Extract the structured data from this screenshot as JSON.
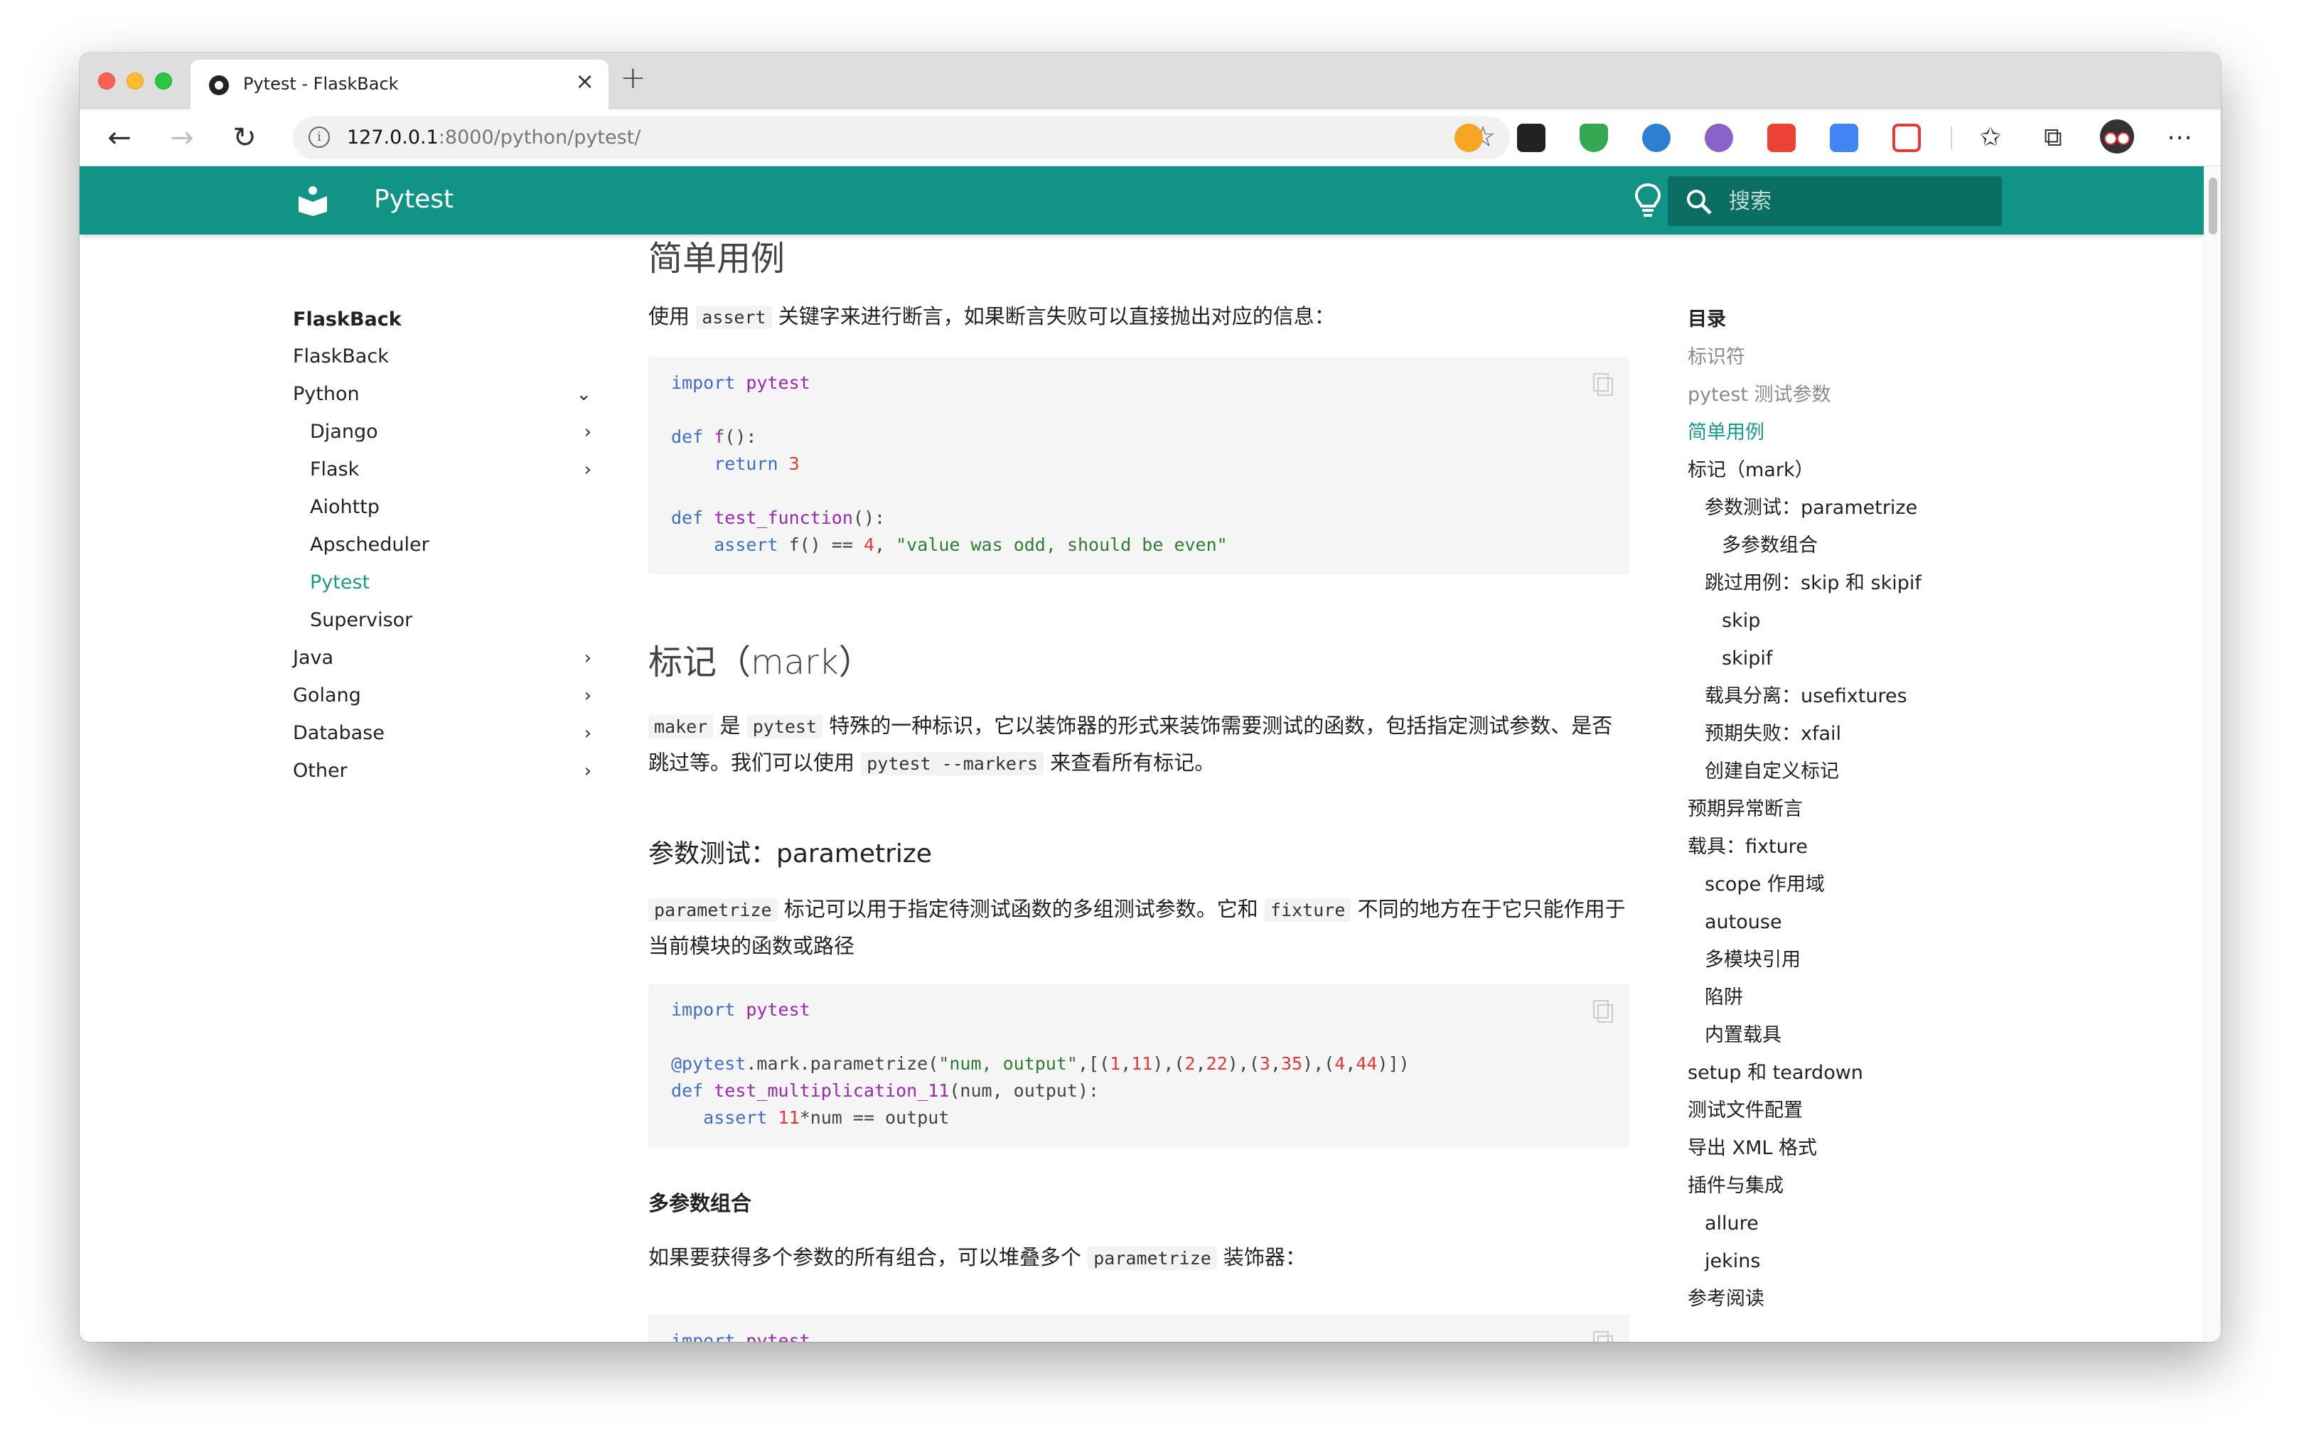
{
  "browser": {
    "tab_title": "Pytest - FlaskBack",
    "url_host": "127.0.0.1",
    "url_rest": ":8000/python/pytest/"
  },
  "header": {
    "title": "Pytest",
    "search_placeholder": "搜索",
    "color": "#119385"
  },
  "left_nav": [
    {
      "label": "FlaskBack",
      "level": 0,
      "style": "section"
    },
    {
      "label": "FlaskBack",
      "level": 0
    },
    {
      "label": "Python",
      "level": 0,
      "chevron": "down"
    },
    {
      "label": "Django",
      "level": 1,
      "chevron": "right"
    },
    {
      "label": "Flask",
      "level": 1,
      "chevron": "right"
    },
    {
      "label": "Aiohttp",
      "level": 1
    },
    {
      "label": "Apscheduler",
      "level": 1
    },
    {
      "label": "Pytest",
      "level": 1,
      "style": "active"
    },
    {
      "label": "Supervisor",
      "level": 1
    },
    {
      "label": "Java",
      "level": 0,
      "chevron": "right"
    },
    {
      "label": "Golang",
      "level": 0,
      "chevron": "right"
    },
    {
      "label": "Database",
      "level": 0,
      "chevron": "right"
    },
    {
      "label": "Other",
      "level": 0,
      "chevron": "right"
    }
  ],
  "content": {
    "h_simple": "简单用例",
    "p_simple_1": "使用",
    "p_simple_code": "assert",
    "p_simple_2": "关键字来进行断言，如果断言失败可以直接抛出对应的信息：",
    "code1": {
      "l1_kw": "import",
      "l1_mod": "pytest",
      "l2_kw": "def",
      "l2_fn": "f",
      "l3_kw": "return",
      "l3_num": "3",
      "l4_kw": "def",
      "l4_fn": "test_function",
      "l5_kw": "assert",
      "l5_mid": " f() == ",
      "l5_num": "4",
      "l5_str": "\"value was odd, should be even\""
    },
    "h_mark": "标记（mark）",
    "p_mark_code1": "maker",
    "p_mark_1": "是",
    "p_mark_code2": "pytest",
    "p_mark_2": "特殊的一种标识，它以装饰器的形式来装饰需要测试的函数，包括指定测试参数、是否跳过等。我们可以使用",
    "p_mark_code3": "pytest --markers",
    "p_mark_3": "来查看所有标记。",
    "h_param": "参数测试：parametrize",
    "p_param_code1": "parametrize",
    "p_param_1": "标记可以用于指定待测试函数的多组测试参数。它和",
    "p_param_code2": "fixture",
    "p_param_2": "不同的地方在于它只能作用于当前模块的函数或路径",
    "code2": {
      "l1_kw": "import",
      "l1_mod": "pytest",
      "l2_dec": "@pytest",
      "l2_mid": ".mark.parametrize(",
      "l2_str": "\"num, output\"",
      "l3_kw": "def",
      "l3_fn": "test_multiplication_11",
      "l3_rest": "(num, output):",
      "l4_kw": "assert",
      "l4_num": "11",
      "l4_rest": "*num == output"
    },
    "h_multi": "多参数组合",
    "p_multi_1": "如果要获得多个参数的所有组合，可以堆叠多个",
    "p_multi_code": "parametrize",
    "p_multi_2": "装饰器：",
    "code3": {
      "l1_kw": "import",
      "l1_mod": "pytest"
    }
  },
  "toc": [
    {
      "label": "目录",
      "level": 0,
      "style": "title"
    },
    {
      "label": "标识符",
      "level": 0,
      "style": "muted"
    },
    {
      "label": "pytest 测试参数",
      "level": 0,
      "style": "muted"
    },
    {
      "label": "简单用例",
      "level": 0,
      "style": "active"
    },
    {
      "label": "标记（mark）",
      "level": 0
    },
    {
      "label": "参数测试：parametrize",
      "level": 1
    },
    {
      "label": "多参数组合",
      "level": 2
    },
    {
      "label": "跳过用例：skip 和 skipif",
      "level": 1
    },
    {
      "label": "skip",
      "level": 2
    },
    {
      "label": "skipif",
      "level": 2
    },
    {
      "label": "载具分离：usefixtures",
      "level": 1
    },
    {
      "label": "预期失败：xfail",
      "level": 1
    },
    {
      "label": "创建自定义标记",
      "level": 1
    },
    {
      "label": "预期异常断言",
      "level": 0
    },
    {
      "label": "载具：fixture",
      "level": 0
    },
    {
      "label": "scope 作用域",
      "level": 1
    },
    {
      "label": "autouse",
      "level": 1
    },
    {
      "label": "多模块引用",
      "level": 1
    },
    {
      "label": "陷阱",
      "level": 1
    },
    {
      "label": "内置载具",
      "level": 1
    },
    {
      "label": "setup 和 teardown",
      "level": 0
    },
    {
      "label": "测试文件配置",
      "level": 0
    },
    {
      "label": "导出 XML 格式",
      "level": 0
    },
    {
      "label": "插件与集成",
      "level": 0
    },
    {
      "label": "allure",
      "level": 1
    },
    {
      "label": "jekins",
      "level": 1
    },
    {
      "label": "参考阅读",
      "level": 0
    }
  ]
}
